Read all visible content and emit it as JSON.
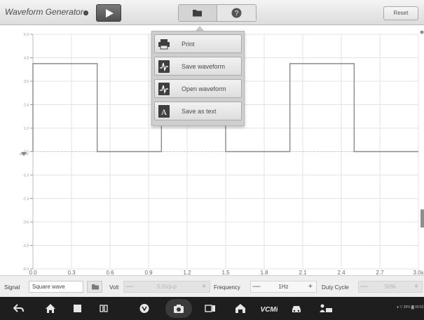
{
  "app": {
    "title": "Waveform Generator"
  },
  "toolbar": {
    "reset_label": "Reset"
  },
  "menu": {
    "items": [
      {
        "label": "Print",
        "icon": "printer-icon"
      },
      {
        "label": "Save waveform",
        "icon": "save-waveform-icon"
      },
      {
        "label": "Open waveform",
        "icon": "open-waveform-icon"
      },
      {
        "label": "Save as text",
        "icon": "save-text-icon"
      }
    ]
  },
  "chart_data": {
    "type": "line",
    "x_ticks": [
      "0.0",
      "0.3",
      "0.6",
      "0.9",
      "1.2",
      "1.5",
      "1.8",
      "2.1",
      "2.4",
      "2.7",
      "3.0s"
    ],
    "y_ticks": [
      "6.0",
      "4.8",
      "3.6",
      "2.4",
      "1.2",
      "0.0",
      "-1.2",
      "-2.4",
      "-3.6",
      "-4.8",
      "-6.0"
    ],
    "xlim": [
      0,
      3.0
    ],
    "ylim": [
      -6.0,
      6.0
    ],
    "grid": true,
    "series": [
      {
        "color": "#8a8a8a",
        "x": [
          0.0,
          0.0,
          0.5,
          0.5,
          1.0,
          1.0,
          1.5,
          1.5,
          2.0,
          2.0,
          2.5,
          2.5,
          3.0
        ],
        "y": [
          0.0,
          4.5,
          4.5,
          0.0,
          0.0,
          4.5,
          4.5,
          0.0,
          0.0,
          4.5,
          4.5,
          0.0,
          0.0
        ]
      }
    ]
  },
  "controls": {
    "signal_label": "Signal",
    "signal_value": "Square wave",
    "volt_label": "Volt",
    "volt_value": "5.0Vp-p",
    "frequency_label": "Frequency",
    "frequency_value": "1Hz",
    "duty_label": "Duty Cycle",
    "duty_value": "50%",
    "minus": "—",
    "plus": "+"
  },
  "navbar": {
    "status": "● ▽ 39% ▓ 09:52"
  },
  "colors": {
    "accent_dark": "#4f4f4f",
    "navbar_bg": "#1e1e1e",
    "waveform": "#8a8a8a"
  }
}
